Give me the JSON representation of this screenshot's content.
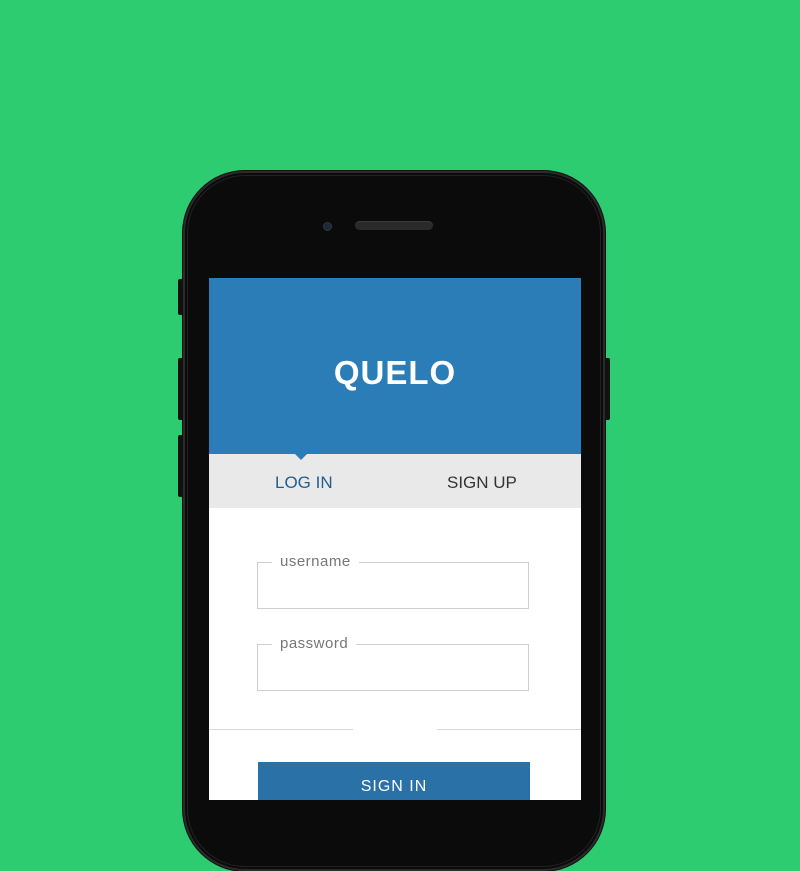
{
  "app": {
    "title": "QUELO"
  },
  "tabs": [
    {
      "label": "LOG IN",
      "active": true
    },
    {
      "label": "SIGN UP",
      "active": false
    }
  ],
  "form": {
    "username": {
      "label": "username",
      "value": ""
    },
    "password": {
      "label": "password",
      "value": ""
    },
    "submit_label": "SIGN IN"
  },
  "colors": {
    "background": "#2ecc71",
    "header": "#2a7db6",
    "active_tab": "#1f5f93",
    "button": "#2a71a8"
  }
}
